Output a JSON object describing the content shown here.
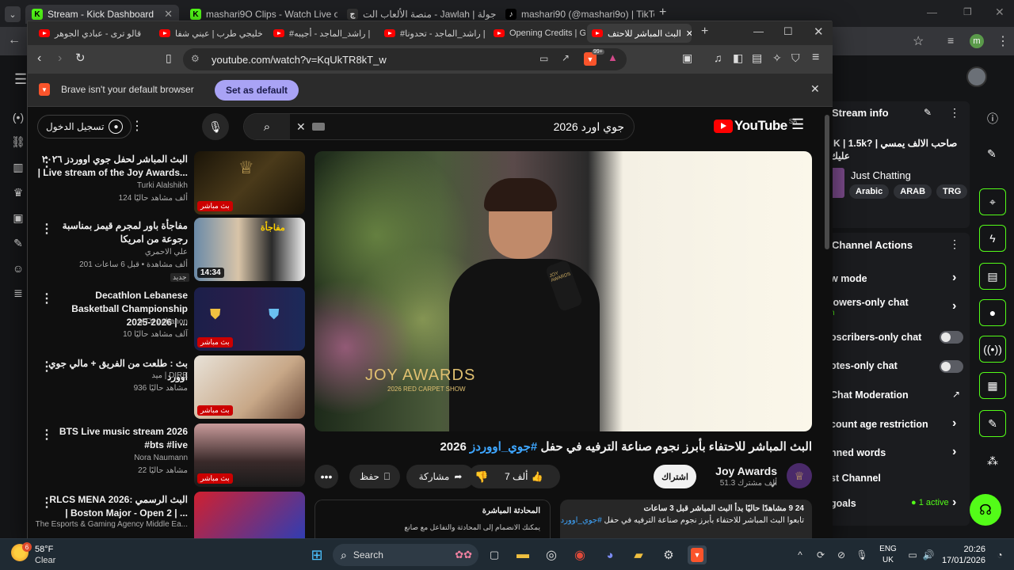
{
  "chrome": {
    "tabs": [
      {
        "label": "Stream - Kick Dashboard"
      },
      {
        "label": "mashari9O Clips - Watch Live o"
      },
      {
        "label": "منصة الألعاب الت - Jawlah | جولة"
      },
      {
        "label": "mashari90 (@mashari9o) | TikTo"
      }
    ],
    "new_tab": "+",
    "profile_initial": "m"
  },
  "brave": {
    "tabs": [
      {
        "label": "قالو ترى - عبادي الجوهر"
      },
      {
        "label": "خليجي طرب | عيني شفا"
      },
      {
        "label": "#راشد_الماجد - أجيبه |"
      },
      {
        "label": "#راشد_الماجد - تحدونا |"
      },
      {
        "label": "Opening Credits | Gan"
      },
      {
        "label": "البث المباشر للاحتف"
      }
    ],
    "url": "youtube.com/watch?v=KqUkTR8kT_w",
    "ext_badge": "99+",
    "infobar": {
      "message": "Brave isn't your default browser",
      "button": "Set as default"
    }
  },
  "youtube": {
    "logo_text": "YouTube",
    "region": "SA",
    "search_value": "جوي اورد 2026",
    "sign_in": "تسجيل الدخول",
    "video": {
      "title": "البث المباشر للاحتفاء بأبرز نجوم صناعة الترفيه في حفل",
      "hashtag": "#جوي_اووردز",
      "year": "2026",
      "overlay_brand": "JOY AWARDS",
      "overlay_sub": "2026 RED CARPET SHOW",
      "mic_label": "JOY AWARDS"
    },
    "channel": {
      "name": "Joy Awards",
      "subs": "51.3 ألف مشترك",
      "subscribe": "اشتراك"
    },
    "actions": {
      "likes": "7 ألف",
      "share": "مشاركة",
      "save": "حفظ"
    },
    "description": {
      "views": "9 مشاهدًا حاليًا  بدأ البث المباشر قبل 3 ساعات",
      "count_prefix": "24",
      "line2_text": "تابعوا البث المباشر للاحتفاء بأبرز نجوم صناعة الترفيه في حفل",
      "line2_tag": "#جوي_اووردز"
    },
    "live_chat": {
      "title": "المحادثة المباشرة",
      "hint": "يمكنك الانضمام إلى المحادثة والتفاعل مع صانع"
    },
    "related": [
      {
        "title": "البث المباشر لحفل جوي اووردز ٢٠٢٦ | Live stream of the Joy Awards...",
        "channel": "Turki Alalshikh",
        "meta": "124 ألف مشاهد حاليًا",
        "badge": "بث مباشر",
        "duration": ""
      },
      {
        "title": "مفاجأة باور لمجرم قيمز بمناسبة رجوعة من امريكا",
        "channel": "علي الاحمري",
        "meta": "201 ألف مشاهدة • قبل 6 ساعات",
        "badge": "",
        "duration": "14:34",
        "new": "جديد"
      },
      {
        "title": "Decathlon Lebanese Basketball Championship 2025-2026 | ...",
        "channel": "MTV Lebanon",
        "meta": "10 آلف مشاهد حاليًا",
        "badge": "بث مباشر",
        "duration": ""
      },
      {
        "title": "بث : طلعت من الفريق + مالي جوي اوورد",
        "channel": "ميد | DIRE",
        "meta": "936 مشاهد حاليًا",
        "badge": "بث مباشر",
        "duration": ""
      },
      {
        "title": "BTS Live music stream 2026 #bts #live",
        "channel": "Nora Naumann",
        "meta": "22 مشاهد حاليًا",
        "badge": "بث مباشر",
        "duration": ""
      },
      {
        "title": "RLCS MENA 2026: البث الرسمي | Boston Major - Open 2 | ...",
        "channel": "The Esports & Gaming Agency Middle Ea...",
        "meta": "",
        "badge": "",
        "duration": ""
      }
    ]
  },
  "kick": {
    "stream_info": "Stream info",
    "stream_title": "!K | 1.5k? | صاحب الالف يمسي",
    "stream_title2": "عليك",
    "category": "Just Chatting",
    "tags": [
      "Arabic",
      "ARAB",
      "TRG"
    ],
    "channel_actions": "Channel Actions",
    "items": [
      {
        "label": "w mode"
      },
      {
        "label": "lowers-only chat",
        "sub": "n"
      },
      {
        "label": "oscribers-only chat"
      },
      {
        "label": "otes-only chat"
      },
      {
        "label": "Chat Moderation"
      },
      {
        "label": "count age restriction"
      },
      {
        "label": "nned words"
      },
      {
        "label": "st Channel"
      },
      {
        "label": "goals",
        "sub": "1 active"
      }
    ]
  },
  "taskbar": {
    "weather_temp": "58°F",
    "weather_desc": "Clear",
    "weather_badge": "6",
    "search": "Search",
    "lang": "ENG",
    "region": "UK",
    "time": "20:26",
    "date": "17/01/2026"
  },
  "colors": {
    "kick_green": "#53fc18",
    "yt_red": "#ff0000",
    "brave_purple": "#a9a3f5"
  }
}
